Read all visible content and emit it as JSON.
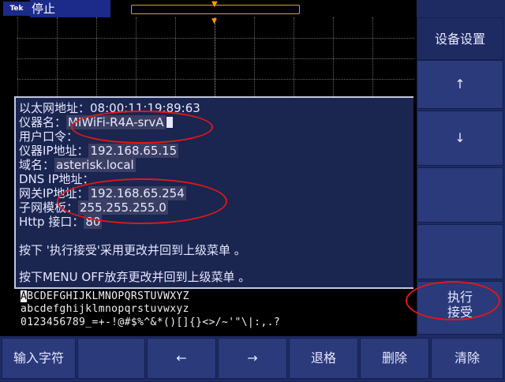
{
  "status": {
    "logo": "Tek",
    "state": "停止"
  },
  "right_menu": {
    "title": "设备设置",
    "up_arrow": "↑",
    "down_arrow": "↓",
    "execute_accept": "执行\n接受"
  },
  "settings": {
    "ethernet_address_label": "以太网地址：",
    "ethernet_address": "08:00:11:19:89:63",
    "instrument_name_label": "仪器名：",
    "instrument_name": "MIWiFi-R4A-srvA",
    "user_password_label": "用户口令：",
    "instrument_ip_label": "仪器IP地址：",
    "instrument_ip": "192.168.65.15",
    "domain_label": "域名：",
    "domain": "asterisk.local",
    "dns_ip_label": "DNS IP地址：",
    "gateway_ip_label": "网关IP地址：",
    "gateway_ip": "192.168.65.254",
    "subnet_mask_label": "子网模板：",
    "subnet_mask": "255.255.255.0",
    "http_port_label": "Http 接口：",
    "http_port": "80",
    "hint_accept": "按下 '执行接受'采用更改并回到上级菜单 。",
    "hint_menu_off": "按下MENU OFF放弃更改并回到上级菜单 。"
  },
  "charset": {
    "selected": "A",
    "upper_rest": "BCDEFGHIJKLMNOPQRSTUVWXYZ",
    "lower": "abcdefghijklmnopqrstuvwxyz",
    "symbols": "0123456789_=+-!@#$%^&*()[]{}<>/~'\"\\|:,.?"
  },
  "bottom_menu": {
    "enter_char": "输入字符",
    "left_arrow": "←",
    "right_arrow": "→",
    "backspace": "退格",
    "delete": "删除",
    "clear": "清除"
  },
  "colors": {
    "panel": "#1e2b63",
    "dialog": "#1a2550",
    "annotation": "#e01818"
  }
}
